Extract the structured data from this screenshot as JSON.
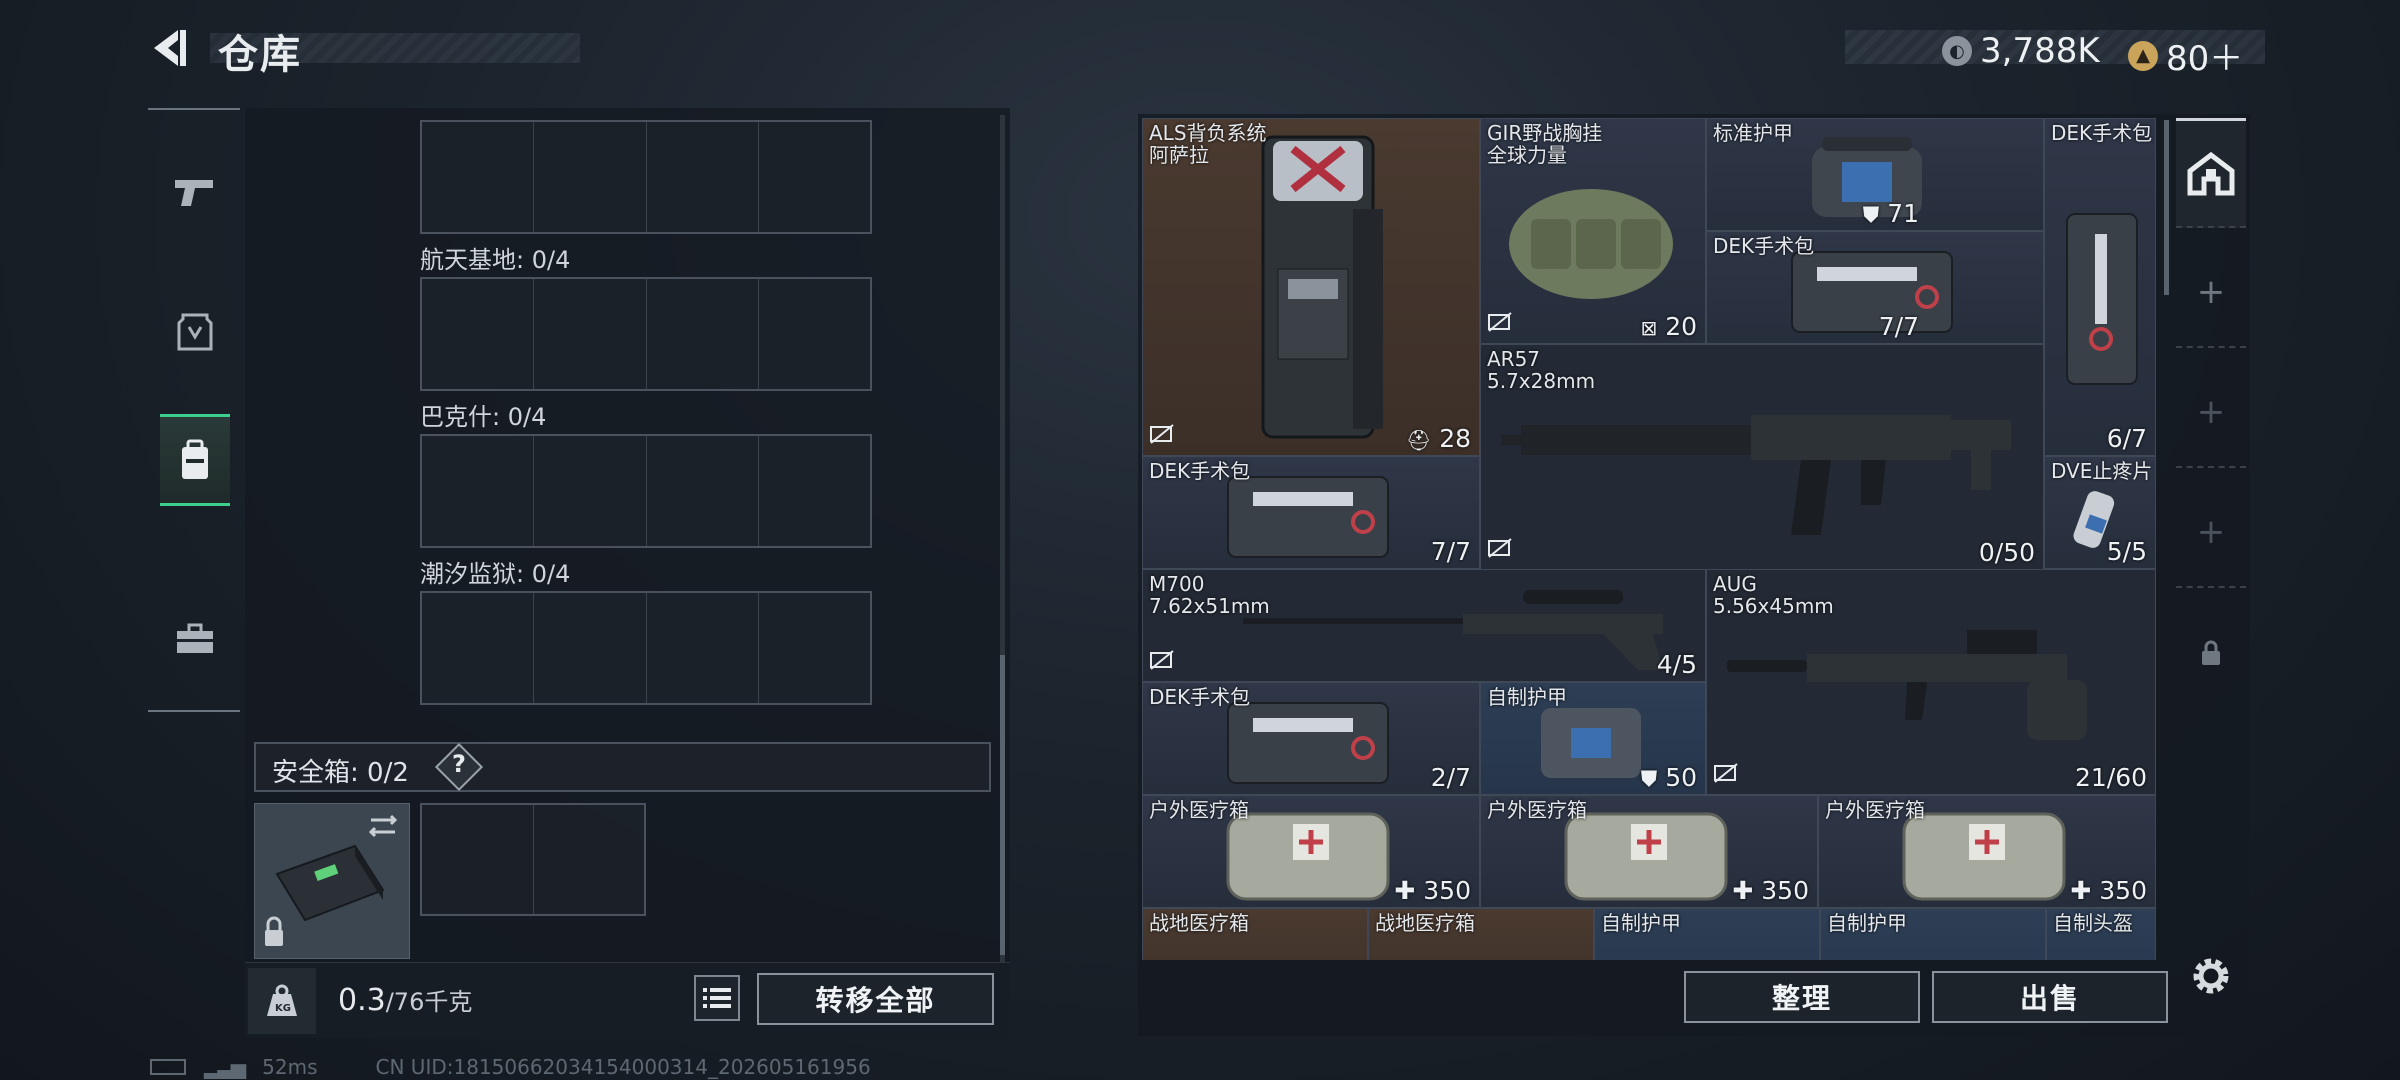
{
  "header": {
    "title": "仓库",
    "back_icon": "back-arrow-icon",
    "currency": [
      {
        "icon": "coin-icon",
        "value": "3,788K",
        "color": "#aeb6bd"
      },
      {
        "icon": "premium-coin-icon",
        "value": "80＋",
        "color": "#c9a45a"
      }
    ]
  },
  "rail": {
    "items": [
      {
        "icon": "pistol-icon",
        "active": false
      },
      {
        "icon": "armor-icon",
        "active": false
      },
      {
        "icon": "backpack-icon",
        "active": true
      },
      {
        "icon": "briefcase-icon",
        "active": false
      }
    ],
    "active_color": "#3dcf8e"
  },
  "stash": {
    "sections": [
      {
        "label": ""
      },
      {
        "label": "航天基地: 0/4"
      },
      {
        "label": "巴克什: 0/4"
      },
      {
        "label": "潮汐监狱: 0/4"
      }
    ],
    "safe_box": {
      "label": "安全箱: 0/2",
      "help": "?"
    },
    "weight": {
      "value": "0.3",
      "max": "/76千克",
      "icon": "kg-weight-icon"
    },
    "transfer_all": "转移全部"
  },
  "inventory": {
    "items": [
      {
        "name": "ALS背负系统\n阿萨拉",
        "count": "28",
        "count_icon": "helmet-icon",
        "bg": "brown"
      },
      {
        "name": "GIR野战胸挂\n全球力量",
        "count": "20",
        "count_icon": "vest-icon",
        "bg": "gray"
      },
      {
        "name": "标准护甲",
        "count": "71",
        "count_icon": "shield-icon",
        "bg": "gray"
      },
      {
        "name": "DEK手术包",
        "count": "7/7",
        "bg": "gray"
      },
      {
        "name": "DEK手术包",
        "count": "6/7",
        "bg": "gray"
      },
      {
        "name": "AR57\n5.7x28mm",
        "count": "0/50",
        "bg": "dark"
      },
      {
        "name": "DEK手术包",
        "count": "7/7",
        "bg": "gray"
      },
      {
        "name": "DVE止疼片",
        "count": "5/5",
        "bg": "gray"
      },
      {
        "name": "M700\n7.62x51mm",
        "count": "4/5",
        "bg": "dark"
      },
      {
        "name": "AUG\n5.56x45mm",
        "count": "21/60",
        "bg": "dark"
      },
      {
        "name": "DEK手术包",
        "count": "2/7",
        "bg": "gray"
      },
      {
        "name": "自制护甲",
        "count": "50",
        "count_icon": "shield-icon",
        "bg": "blue"
      },
      {
        "name": "户外医疗箱",
        "count": "350",
        "count_icon": "plus-icon",
        "bg": "gray"
      },
      {
        "name": "户外医疗箱",
        "count": "350",
        "count_icon": "plus-icon",
        "bg": "gray"
      },
      {
        "name": "户外医疗箱",
        "count": "350",
        "count_icon": "plus-icon",
        "bg": "gray"
      },
      {
        "name": "战地医疗箱",
        "count": "",
        "bg": "brown"
      },
      {
        "name": "战地医疗箱",
        "count": "",
        "bg": "brown"
      },
      {
        "name": "自制护甲",
        "count": "",
        "bg": "blue"
      },
      {
        "name": "自制护甲",
        "count": "",
        "bg": "blue"
      },
      {
        "name": "自制头盔",
        "count": "",
        "bg": "blue"
      }
    ],
    "side_buttons": [
      "home-icon",
      "+",
      "+",
      "+",
      "lock-icon"
    ],
    "sort_button": "整理",
    "sell_button": "出售"
  },
  "status": {
    "ping": "52ms",
    "uid": "CN UID:18150662034154000314_202605161956"
  }
}
